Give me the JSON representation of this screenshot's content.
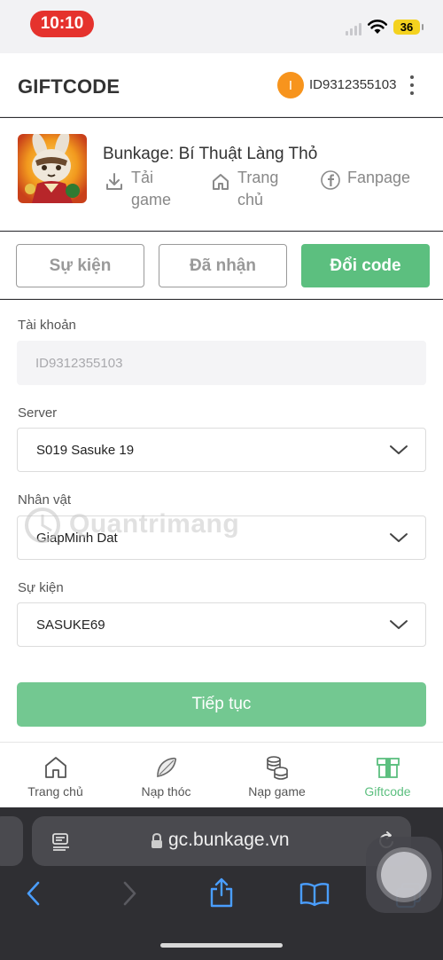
{
  "status": {
    "time": "10:10",
    "battery": "36"
  },
  "header": {
    "brand": "GIFTCODE",
    "avatar_letter": "I",
    "user_id": "ID9312355103",
    "more_icon": "more-vertical-icon"
  },
  "game": {
    "title": "Bunkage: Bí Thuật Làng Thỏ",
    "links": [
      {
        "label_line1": "Tải",
        "label_line2": "game",
        "icon": "download-icon"
      },
      {
        "label_line1": "Trang",
        "label_line2": "chủ",
        "icon": "home-icon"
      },
      {
        "label_line1": "Fanpage",
        "label_line2": "",
        "icon": "facebook-icon"
      }
    ]
  },
  "tabs": [
    {
      "label": "Sự kiện",
      "active": false
    },
    {
      "label": "Đã nhận",
      "active": false
    },
    {
      "label": "Đổi code",
      "active": true
    }
  ],
  "form": {
    "account": {
      "label": "Tài khoản",
      "value": "ID9312355103"
    },
    "server": {
      "label": "Server",
      "value": "S019 Sasuke 19"
    },
    "character": {
      "label": "Nhân vật",
      "value": "GiapMinh Dat"
    },
    "event": {
      "label": "Sự kiện",
      "value": "SASUKE69"
    },
    "submit_label": "Tiếp tục"
  },
  "watermark": "Quantrimang",
  "bottom_nav": [
    {
      "label": "Trang chủ",
      "icon": "home-icon",
      "active": false
    },
    {
      "label": "Nạp thóc",
      "icon": "leaf-icon",
      "active": false
    },
    {
      "label": "Nạp game",
      "icon": "coins-icon",
      "active": false
    },
    {
      "label": "Giftcode",
      "icon": "gift-icon",
      "active": true
    }
  ],
  "browser": {
    "url": "gc.bunkage.vn"
  },
  "colors": {
    "accent": "#5cbf7f",
    "button_light": "#73c891",
    "avatar": "#f7941d",
    "time_pill": "#e5322d"
  }
}
